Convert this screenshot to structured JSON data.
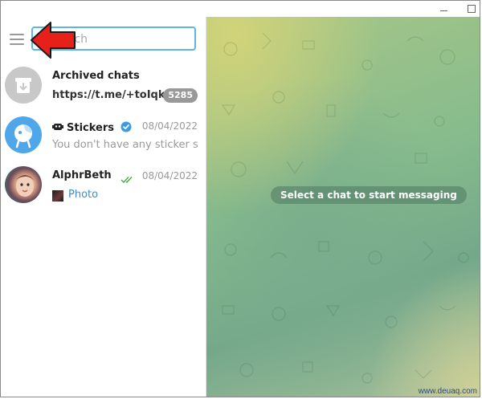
{
  "window": {
    "minimize_icon": "minimize-icon",
    "maximize_icon": "maximize-icon"
  },
  "sidebar": {
    "menu_icon": "hamburger-menu-icon",
    "search_placeholder_visible": "rch",
    "annotation_arrow_color": "#e8201a",
    "chats": [
      {
        "name": "Archived chats",
        "message": "https://t.me/+toIqks...",
        "badge": "5285",
        "date": "",
        "avatar_icon": "archive-icon"
      },
      {
        "name": "Stickers",
        "message": "You don't have any sticker se...",
        "date": "08/04/2022",
        "verified_icon": "verified-badge-icon",
        "bot_icon": "bot-icon",
        "avatar_icon": "sticker-bot-avatar"
      },
      {
        "name": "AlphrBeth",
        "message": "Photo",
        "date": "08/04/2022",
        "read_icon": "double-check-icon",
        "avatar_icon": "user-photo-avatar"
      }
    ]
  },
  "main": {
    "placeholder": "Select a chat to start messaging"
  },
  "watermark": "www.deuaq.com",
  "colors": {
    "accent": "#5eb5e4",
    "badge": "#999999",
    "link": "#3a8fc9",
    "check": "#4fae4e"
  }
}
